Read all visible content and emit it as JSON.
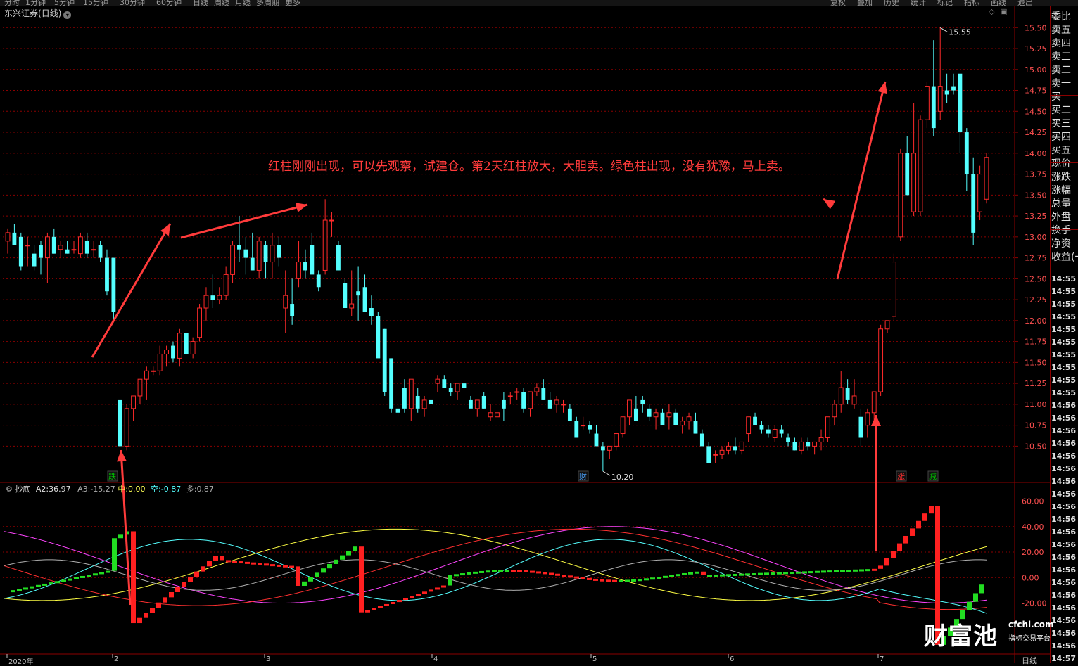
{
  "toolbar": {
    "items": [
      "分时",
      "1分钟",
      "5分钟",
      "15分钟",
      "30分钟",
      "60分钟",
      "日线",
      "周线",
      "月线",
      "多周期",
      "更多"
    ],
    "right_items": [
      "复权",
      "叠加",
      "历史",
      "统计",
      "标记",
      "指标",
      "画线",
      "退出"
    ]
  },
  "chart_title": {
    "stock": "东兴证券",
    "period": "(日线)"
  },
  "annotation": "红柱刚刚出现，可以先观察，试建仓。第2天红柱放大，大胆卖。绿色柱出现，没有犹豫，马上卖。",
  "indicator_header": {
    "name": "抄底",
    "a2_label": "A2:",
    "a2_value": "36.97",
    "a3_label": "A3:",
    "a3_value": "-15.27",
    "mid_label": "中:",
    "mid_value": "0.00",
    "short_label": "空:",
    "short_value": "-0.87",
    "long_label": "多:",
    "long_value": "0.87"
  },
  "price_markers": {
    "high": "15.55",
    "low": "10.20"
  },
  "event_tags": [
    {
      "text": "跌",
      "color": "#00c000"
    },
    {
      "text": "财",
      "color": "#4aa3ff"
    },
    {
      "text": "涨",
      "color": "#ff3030"
    },
    {
      "text": "减",
      "color": "#00c000"
    }
  ],
  "dates": [
    "2020年",
    "2",
    "3",
    "4",
    "5",
    "6",
    "7"
  ],
  "period_label": "日线",
  "right_panel": {
    "labels": [
      "委比",
      "卖五",
      "卖四",
      "卖三",
      "卖二",
      "卖一",
      "买一",
      "买二",
      "买三",
      "买四",
      "买五",
      "现价",
      "涨跌",
      "涨幅",
      "总量",
      "外盘",
      "换手",
      "净资",
      "收益(一"
    ],
    "times": [
      "14:55",
      "14:55",
      "14:55",
      "14:55",
      "14:55",
      "14:55",
      "14:55",
      "14:55",
      "14:55",
      "14:55",
      "14:56",
      "14:56",
      "14:56",
      "14:56",
      "14:56",
      "14:56",
      "14:56",
      "14:56",
      "14:56",
      "14:56",
      "14:56",
      "14:56",
      "14:56",
      "14:56",
      "14:56",
      "14:56",
      "14:56",
      "14:56",
      "14:56",
      "14:56",
      "14:57"
    ]
  },
  "watermark": {
    "name": "财富池",
    "url": "cfchi.com",
    "slogan": "指标交易平台"
  },
  "colors": {
    "up": "#ff2a2a",
    "down": "#54ffff",
    "grid": "#8b0000",
    "annotation": "#ff3b3b",
    "arrow": "#ff3b3b"
  },
  "chart_data": [
    {
      "type": "candlestick",
      "title": "东兴证券 (日线)",
      "yaxis_ticks": [
        10.5,
        10.75,
        11.0,
        11.25,
        11.5,
        11.75,
        12.0,
        12.25,
        12.5,
        12.75,
        13.0,
        13.25,
        13.5,
        13.75,
        14.0,
        14.25,
        14.5,
        14.75,
        15.0,
        15.25,
        15.5
      ],
      "ylim": [
        10.1,
        15.62
      ],
      "x_labels": [
        "2020年",
        "2",
        "3",
        "4",
        "5",
        "6",
        "7"
      ],
      "ohlc": [
        [
          12.95,
          13.1,
          12.8,
          13.05
        ],
        [
          13.05,
          13.15,
          12.9,
          12.9
        ],
        [
          13.0,
          13.05,
          12.6,
          12.65
        ],
        [
          12.9,
          13.0,
          12.65,
          12.9
        ],
        [
          12.8,
          12.9,
          12.6,
          12.65
        ],
        [
          12.9,
          12.95,
          12.55,
          12.75
        ],
        [
          12.75,
          13.05,
          12.45,
          13.0
        ],
        [
          13.0,
          13.1,
          12.8,
          12.8
        ],
        [
          12.85,
          12.95,
          12.75,
          12.9
        ],
        [
          12.85,
          12.95,
          12.8,
          12.8
        ],
        [
          12.85,
          12.95,
          12.8,
          12.85
        ],
        [
          12.8,
          13.05,
          12.75,
          13.0
        ],
        [
          12.95,
          13.05,
          12.75,
          12.8
        ],
        [
          12.85,
          12.95,
          12.75,
          12.85
        ],
        [
          12.9,
          12.95,
          12.7,
          12.75
        ],
        [
          12.75,
          12.85,
          12.3,
          12.35
        ],
        [
          12.75,
          12.75,
          12.0,
          12.1
        ],
        [
          11.05,
          11.05,
          10.5,
          10.5
        ],
        [
          10.5,
          11.0,
          10.45,
          10.95
        ],
        [
          10.95,
          11.1,
          10.8,
          11.1
        ],
        [
          11.1,
          11.3,
          11.0,
          11.3
        ],
        [
          11.3,
          11.45,
          11.05,
          11.4
        ],
        [
          11.4,
          11.45,
          11.35,
          11.4
        ],
        [
          11.4,
          11.7,
          11.35,
          11.6
        ],
        [
          11.6,
          11.7,
          11.45,
          11.65
        ],
        [
          11.7,
          11.75,
          11.5,
          11.55
        ],
        [
          11.55,
          11.9,
          11.45,
          11.85
        ],
        [
          11.85,
          11.85,
          11.6,
          11.6
        ],
        [
          11.6,
          11.8,
          11.55,
          11.75
        ],
        [
          11.8,
          12.2,
          11.75,
          12.15
        ],
        [
          12.15,
          12.4,
          12.0,
          12.3
        ],
        [
          12.3,
          12.55,
          12.15,
          12.25
        ],
        [
          12.25,
          12.4,
          12.2,
          12.3
        ],
        [
          12.3,
          12.65,
          12.25,
          12.55
        ],
        [
          12.55,
          12.95,
          12.45,
          12.9
        ],
        [
          12.9,
          13.25,
          12.7,
          12.85
        ],
        [
          12.85,
          13.0,
          12.55,
          12.75
        ],
        [
          12.75,
          13.05,
          12.6,
          12.6
        ],
        [
          12.6,
          13.0,
          12.5,
          12.95
        ],
        [
          12.9,
          12.95,
          12.5,
          12.7
        ],
        [
          12.7,
          13.05,
          12.5,
          12.9
        ],
        [
          12.9,
          13.0,
          12.65,
          12.75
        ],
        [
          12.15,
          12.6,
          11.85,
          12.3
        ],
        [
          12.2,
          12.5,
          11.95,
          12.05
        ],
        [
          12.5,
          12.95,
          12.4,
          12.7
        ],
        [
          12.7,
          12.85,
          12.5,
          12.6
        ],
        [
          12.9,
          13.05,
          12.6,
          12.55
        ],
        [
          12.55,
          12.6,
          12.35,
          12.4
        ],
        [
          12.6,
          13.45,
          12.55,
          13.2
        ],
        [
          13.2,
          13.3,
          13.0,
          13.2
        ],
        [
          12.9,
          12.95,
          12.6,
          12.6
        ],
        [
          12.45,
          12.5,
          12.2,
          12.15
        ],
        [
          12.15,
          12.6,
          12.05,
          12.2
        ],
        [
          12.35,
          12.65,
          12.0,
          12.3
        ],
        [
          12.4,
          12.55,
          12.1,
          12.1
        ],
        [
          12.15,
          12.3,
          11.95,
          12.05
        ],
        [
          12.05,
          12.1,
          11.6,
          11.55
        ],
        [
          11.9,
          11.9,
          11.1,
          11.15
        ],
        [
          11.55,
          11.55,
          10.9,
          10.95
        ],
        [
          10.95,
          11.0,
          10.85,
          10.9
        ],
        [
          11.2,
          11.3,
          10.9,
          10.95
        ],
        [
          10.95,
          11.0,
          10.8,
          11.3
        ],
        [
          11.1,
          11.2,
          10.9,
          10.95
        ],
        [
          10.95,
          11.1,
          10.85,
          11.05
        ],
        [
          11.05,
          11.15,
          11.0,
          11.0
        ],
        [
          11.25,
          11.35,
          11.15,
          11.3
        ],
        [
          11.3,
          11.35,
          11.2,
          11.2
        ],
        [
          11.2,
          11.25,
          11.1,
          11.15
        ],
        [
          11.15,
          11.2,
          11.05,
          11.25
        ],
        [
          11.25,
          11.35,
          11.15,
          11.2
        ],
        [
          11.05,
          11.1,
          11.0,
          10.95
        ],
        [
          10.95,
          11.05,
          10.85,
          11.05
        ],
        [
          11.1,
          11.15,
          10.95,
          10.95
        ],
        [
          10.85,
          11.0,
          10.8,
          10.9
        ],
        [
          10.85,
          11.0,
          10.8,
          10.9
        ],
        [
          11.05,
          11.15,
          10.8,
          10.95
        ],
        [
          11.1,
          11.15,
          11.0,
          11.1
        ],
        [
          11.15,
          11.2,
          11.05,
          11.15
        ],
        [
          11.15,
          11.2,
          10.9,
          10.95
        ],
        [
          10.95,
          11.05,
          10.85,
          11.15
        ],
        [
          11.15,
          11.25,
          11.1,
          11.2
        ],
        [
          11.2,
          11.3,
          11.05,
          11.05
        ],
        [
          11.05,
          11.15,
          10.95,
          10.95
        ],
        [
          11.0,
          11.1,
          10.9,
          11.05
        ],
        [
          11.0,
          11.05,
          10.9,
          11.0
        ],
        [
          10.95,
          11.0,
          10.8,
          10.8
        ],
        [
          10.8,
          10.85,
          10.6,
          10.6
        ],
        [
          10.75,
          10.85,
          10.7,
          10.75
        ],
        [
          10.75,
          10.8,
          10.65,
          10.7
        ],
        [
          10.65,
          10.75,
          10.5,
          10.5
        ],
        [
          10.5,
          10.55,
          10.2,
          10.45
        ],
        [
          10.45,
          10.5,
          10.35,
          10.5
        ],
        [
          10.5,
          10.65,
          10.45,
          10.65
        ],
        [
          10.65,
          10.85,
          10.6,
          10.85
        ],
        [
          10.85,
          11.0,
          10.75,
          11.05
        ],
        [
          10.95,
          11.1,
          10.8,
          10.8
        ],
        [
          11.05,
          11.1,
          10.9,
          11.0
        ],
        [
          10.95,
          11.0,
          10.8,
          10.85
        ],
        [
          10.85,
          10.95,
          10.7,
          10.9
        ],
        [
          10.9,
          10.95,
          10.75,
          10.75
        ],
        [
          10.85,
          11.0,
          10.7,
          10.9
        ],
        [
          10.9,
          10.95,
          10.75,
          10.75
        ],
        [
          10.75,
          10.85,
          10.65,
          10.8
        ],
        [
          10.8,
          10.9,
          10.7,
          10.85
        ],
        [
          10.8,
          10.9,
          10.65,
          10.65
        ],
        [
          10.65,
          10.7,
          10.5,
          10.5
        ],
        [
          10.5,
          10.55,
          10.35,
          10.3
        ],
        [
          10.4,
          10.45,
          10.3,
          10.4
        ],
        [
          10.4,
          10.5,
          10.35,
          10.45
        ],
        [
          10.45,
          10.55,
          10.4,
          10.5
        ],
        [
          10.5,
          10.6,
          10.4,
          10.45
        ],
        [
          10.45,
          10.55,
          10.4,
          10.55
        ],
        [
          10.65,
          10.85,
          10.55,
          10.85
        ],
        [
          10.85,
          10.9,
          10.75,
          10.75
        ],
        [
          10.75,
          10.8,
          10.65,
          10.7
        ],
        [
          10.7,
          10.75,
          10.6,
          10.65
        ],
        [
          10.6,
          10.75,
          10.55,
          10.7
        ],
        [
          10.7,
          10.75,
          10.6,
          10.65
        ],
        [
          10.6,
          10.65,
          10.5,
          10.55
        ],
        [
          10.55,
          10.6,
          10.45,
          10.45
        ],
        [
          10.45,
          10.6,
          10.4,
          10.55
        ],
        [
          10.55,
          10.6,
          10.45,
          10.5
        ],
        [
          10.5,
          10.55,
          10.4,
          10.55
        ],
        [
          10.55,
          10.7,
          10.45,
          10.6
        ],
        [
          10.6,
          10.85,
          10.55,
          10.85
        ],
        [
          10.85,
          11.05,
          10.75,
          11.0
        ],
        [
          11.0,
          11.4,
          10.9,
          11.2
        ],
        [
          11.2,
          11.3,
          11.0,
          11.05
        ],
        [
          11.0,
          11.3,
          10.95,
          11.1
        ],
        [
          10.85,
          10.95,
          10.5,
          10.6
        ],
        [
          10.75,
          10.95,
          10.6,
          10.9
        ],
        [
          10.9,
          11.1,
          10.8,
          11.15
        ],
        [
          11.15,
          11.95,
          11.1,
          11.9
        ],
        [
          11.9,
          12.0,
          11.85,
          12.0
        ],
        [
          12.05,
          12.8,
          12.0,
          12.7
        ],
        [
          13.0,
          14.05,
          12.95,
          14.0
        ],
        [
          14.0,
          14.2,
          13.5,
          13.5
        ],
        [
          13.3,
          14.6,
          13.25,
          14.0
        ],
        [
          13.3,
          14.45,
          13.25,
          14.4
        ],
        [
          14.4,
          14.85,
          14.3,
          14.8
        ],
        [
          14.8,
          15.35,
          14.2,
          14.3
        ],
        [
          14.5,
          15.5,
          14.4,
          14.8
        ],
        [
          14.75,
          14.95,
          14.6,
          14.7
        ],
        [
          14.8,
          14.95,
          14.7,
          14.75
        ],
        [
          14.95,
          14.85,
          14.0,
          14.25
        ],
        [
          14.25,
          14.3,
          13.55,
          13.75
        ],
        [
          13.75,
          13.95,
          12.9,
          13.05
        ],
        [
          13.3,
          13.85,
          13.2,
          13.75
        ],
        [
          13.45,
          14.0,
          13.4,
          13.95
        ]
      ]
    },
    {
      "type": "line",
      "title": "抄底",
      "yaxis_ticks": [
        -20.0,
        0.0,
        20.0,
        40.0,
        60.0
      ],
      "ylim": [
        -60,
        68
      ],
      "series": [
        {
          "name": "A2",
          "color": "#ff3030"
        },
        {
          "name": "A3",
          "color": "#ff44ff"
        },
        {
          "name": "中",
          "color": "#ffff44"
        },
        {
          "name": "空",
          "color": "#54ffff"
        },
        {
          "name": "多",
          "color": "#c0c0c0"
        }
      ]
    }
  ]
}
